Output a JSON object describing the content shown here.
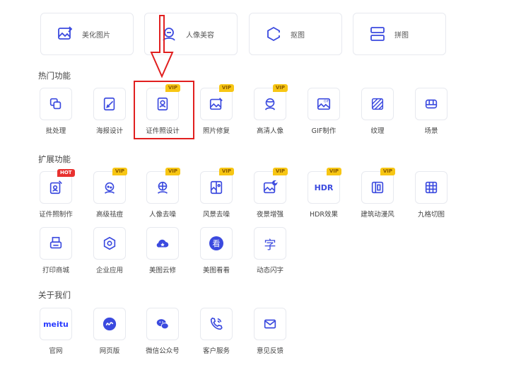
{
  "top_tools": [
    {
      "label": "美化图片",
      "icon": "image-edit-icon"
    },
    {
      "label": "人像美容",
      "icon": "face-beauty-icon"
    },
    {
      "label": "抠图",
      "icon": "cutout-icon"
    },
    {
      "label": "拼图",
      "icon": "collage-icon"
    }
  ],
  "sections": {
    "hot": {
      "title": "热门功能"
    },
    "expand": {
      "title": "扩展功能"
    },
    "about": {
      "title": "关于我们"
    }
  },
  "hot_tools": [
    {
      "label": "批处理",
      "icon": "batch-icon"
    },
    {
      "label": "海报设计",
      "icon": "poster-icon"
    },
    {
      "label": "证件照设计",
      "icon": "id-photo-icon",
      "badge": "VIP"
    },
    {
      "label": "照片修复",
      "icon": "photo-repair-icon",
      "badge": "VIP"
    },
    {
      "label": "高清人像",
      "icon": "hd-portrait-icon",
      "badge": "VIP"
    },
    {
      "label": "GIF制作",
      "icon": "gif-icon"
    },
    {
      "label": "纹理",
      "icon": "texture-icon"
    },
    {
      "label": "场景",
      "icon": "scene-icon"
    }
  ],
  "expand_tools": [
    {
      "label": "证件照制作",
      "icon": "id-photo-make-icon",
      "badge": "HOT"
    },
    {
      "label": "高级祛痘",
      "icon": "acne-removal-icon",
      "badge": "VIP"
    },
    {
      "label": "人像去噪",
      "icon": "portrait-denoise-icon",
      "badge": "VIP"
    },
    {
      "label": "风景去噪",
      "icon": "landscape-denoise-icon",
      "badge": "VIP"
    },
    {
      "label": "夜景增强",
      "icon": "night-enhance-icon",
      "badge": "VIP"
    },
    {
      "label": "HDR效果",
      "icon": "hdr-icon",
      "badge": "VIP",
      "icon_text": "HDR"
    },
    {
      "label": "建筑动漫风",
      "icon": "architecture-anime-icon",
      "badge": "VIP"
    },
    {
      "label": "九格切图",
      "icon": "grid-cut-icon"
    },
    {
      "label": "打印商城",
      "icon": "print-shop-icon"
    },
    {
      "label": "企业应用",
      "icon": "enterprise-icon"
    },
    {
      "label": "美图云修",
      "icon": "cloud-retouch-icon"
    },
    {
      "label": "美图看看",
      "icon": "meitu-viewer-icon",
      "icon_text": "看"
    },
    {
      "label": "动态闪字",
      "icon": "flash-text-icon",
      "icon_text": "字"
    }
  ],
  "about_tools": [
    {
      "label": "官网",
      "icon": "meitu-logo-icon",
      "icon_text": "meitu"
    },
    {
      "label": "网页版",
      "icon": "web-version-icon"
    },
    {
      "label": "微信公众号",
      "icon": "wechat-icon"
    },
    {
      "label": "客户服务",
      "icon": "phone-icon"
    },
    {
      "label": "意见反馈",
      "icon": "mail-icon"
    }
  ],
  "colors": {
    "icon": "#3b4adf",
    "vip": "#f7c614",
    "hot": "#e8312f",
    "annotation": "#e11f1f"
  }
}
